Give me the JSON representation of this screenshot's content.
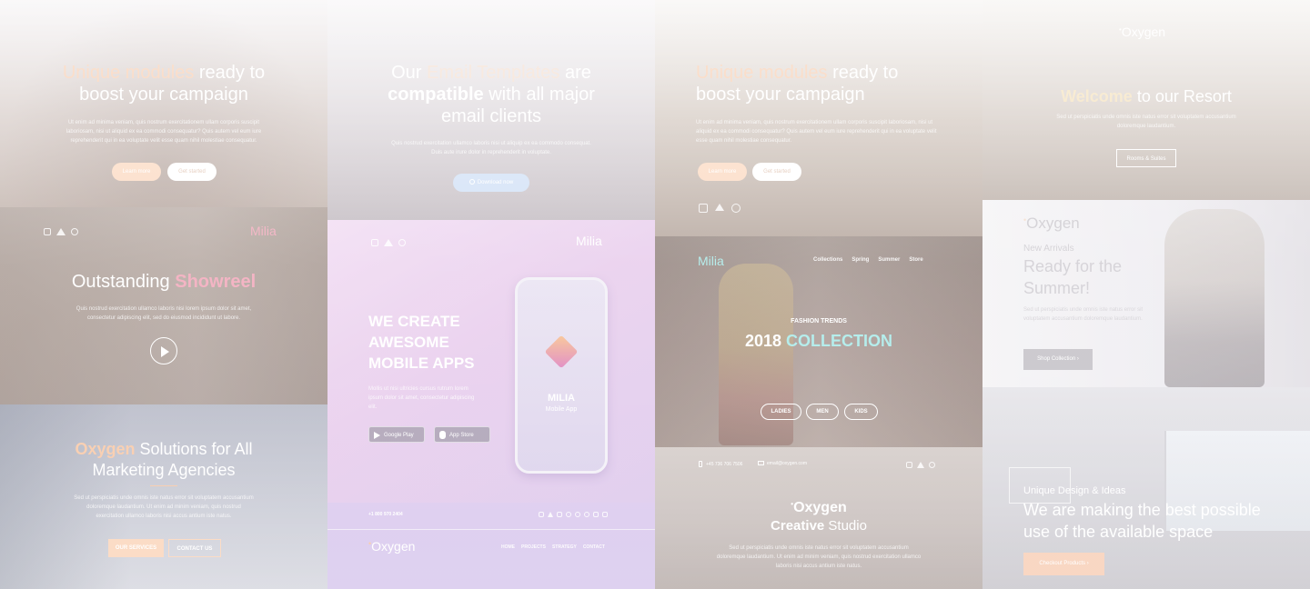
{
  "c1": {
    "top": {
      "title_accent": "Unique modules",
      "title_rest1": " ready to",
      "title_line2": "boost your campaign",
      "body": "Ut enim ad minima veniam, quis nostrum exercitationem ullam corporis suscipit laboriosam, nisi ut aliquid ex ea commodi consequatur? Quis autem vel eum iure reprehenderit qui in ea voluptate velit esse quam nihil molestiae consequatur.",
      "btn_primary": "Learn more",
      "btn_secondary": "Get started"
    },
    "showreel": {
      "logo": "Milia",
      "title": "Outstanding",
      "title_accent": "Showreel",
      "body": "Quis nostrud exercitation ullamco laboris nisi lorem ipsum dolor sit amet, consectetur adipiscing elit, sed do eiusmod incididunt ut labore."
    },
    "agency": {
      "title_accent": "Oxygen",
      "title_rest": " Solutions for All",
      "title_line2": "Marketing Agencies",
      "body": "Sed ut perspiciatis unde omnis iste natus error sit voluptatem accusantium doloremque laudantium. Ut enim ad minim veniam, quis nostrud exercitation ullamco laboris nisi accus antium iste natus.",
      "btn_primary": "OUR SERVICES",
      "btn_secondary": "CONTACT US"
    }
  },
  "c2": {
    "top": {
      "title_line1_a": "Our",
      "title_line1_b": "Email Templates",
      "title_line1_c": " are",
      "title_line2_bold": "compatible",
      "title_line2_rest": " with all major",
      "title_line3": "email clients",
      "body": "Quis nostrud exercitation ullamco laboris nisi ut aliquip ex ea commodo consequat. Duis aute irure dolor in reprehenderit in voluptate.",
      "btn": "Download now"
    },
    "app": {
      "logo": "Milia",
      "headline_1": "WE CREATE",
      "headline_2": "AWESOME",
      "headline_3": "MOBILE APPS",
      "body": "Mollis ut nisi ultricies cursus rutrum lorem ipsum dolor sit amet, consectetur adipiscing elit.",
      "google_play": "Google Play",
      "app_store": "App Store",
      "phone_brand": "MILIA",
      "phone_sub": "Mobile App"
    },
    "footer": {
      "phone": "+1 800 970 2404",
      "logo": "Oxygen",
      "nav": [
        "HOME",
        "PROJECTS",
        "STRATEGY",
        "CONTACT"
      ]
    }
  },
  "c3": {
    "top": {
      "title_accent": "Unique modules",
      "title_rest1": " ready to",
      "title_line2": "boost your campaign",
      "body": "Ut enim ad minima veniam, quis nostrum exercitationem ullam corporis suscipit laboriosam, nisi ut aliquid ex ea commodi consequatur? Quis autem vel eum iure reprehenderit qui in ea voluptate velit esse quam nihil molestiae consequatur.",
      "btn_primary": "Learn more",
      "btn_secondary": "Get started"
    },
    "fashion": {
      "logo": "Milia",
      "nav": [
        "Collections",
        "Spring",
        "Summer",
        "Store"
      ],
      "eyebrow": "FASHION TRENDS",
      "title": "2018",
      "title_accent": "COLLECTION",
      "chips": [
        "LADIES",
        "MEN",
        "KIDS"
      ]
    },
    "studio": {
      "phone": "+45 736 706 7506",
      "email": "email@oxygen.com",
      "logo": "Oxygen",
      "title_bold": "Creative",
      "title_rest": " Studio",
      "body": "Sed ut perspiciatis unde omnis iste natus error sit voluptatem accusantium doloremque laudantium. Ut enim ad minim veniam, quis nostrud exercitation ullamco laboris nisi accus antium iste natus."
    }
  },
  "c4": {
    "resort": {
      "logo": "Oxygen",
      "title_accent": "Welcome",
      "title_rest": " to our Resort",
      "body": "Sed ut perspiciatis unde omnis iste natus error sit voluptatem accusantium doloremque laudantium.",
      "btn": "Rooms & Suites"
    },
    "arrivals": {
      "logo": "Oxygen",
      "eyebrow": "New Arrivals",
      "title_1": "Ready for the",
      "title_2": "Summer!",
      "body": "Sed ut perspiciatis unde omnis iste natus error sit voluptatem accusantium doloremque laudantium.",
      "btn": "Shop Collection"
    },
    "interior": {
      "eyebrow": "Unique Design & Ideas",
      "title_1": "We are making the best possible",
      "title_2": "use of the available space",
      "btn": "Checkout Products"
    }
  },
  "colors": {
    "peach": "#f7c29d",
    "pink": "#f09cb1",
    "teal": "#9ee8e6",
    "lavender": "#e6c9ef"
  }
}
